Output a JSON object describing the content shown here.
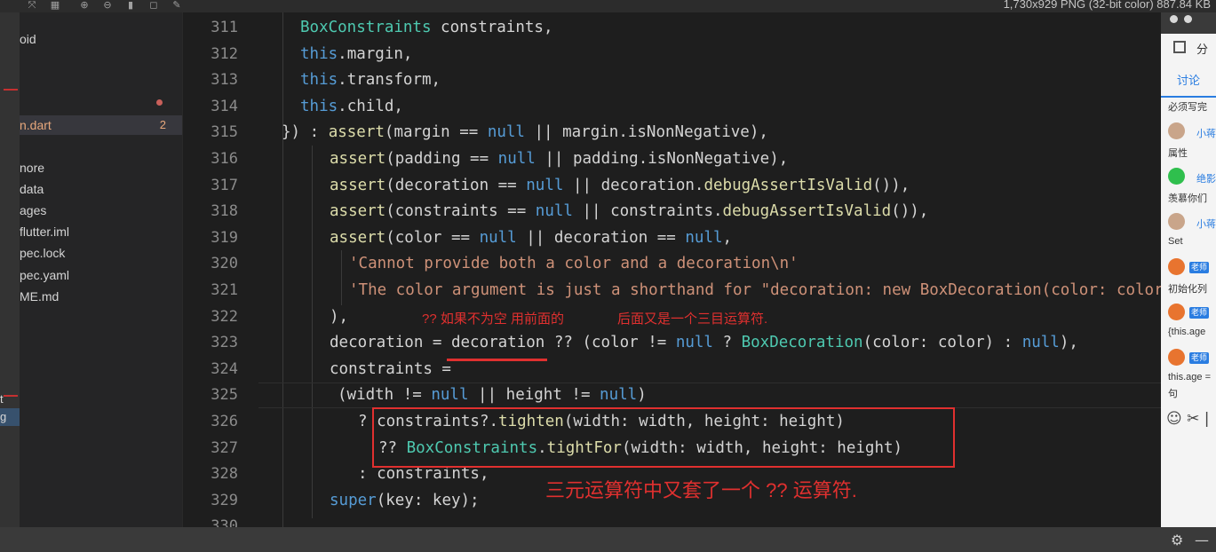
{
  "toolbar": {
    "image_info": "1,730x929 PNG (32-bit color) 887.84 KB"
  },
  "left_strip": {
    "labels": [
      "t",
      "g"
    ]
  },
  "explorer": {
    "items": [
      {
        "label": "oid",
        "badge": ""
      },
      {
        "label": "n.dart",
        "badge": "2"
      },
      {
        "label": "nore",
        "badge": ""
      },
      {
        "label": "data",
        "badge": ""
      },
      {
        "label": "ages",
        "badge": ""
      },
      {
        "label": "flutter.iml",
        "badge": ""
      },
      {
        "label": "pec.lock",
        "badge": ""
      },
      {
        "label": "pec.yaml",
        "badge": ""
      },
      {
        "label": "ME.md",
        "badge": ""
      }
    ]
  },
  "editor": {
    "line_numbers": [
      "311",
      "312",
      "313",
      "314",
      "315",
      "316",
      "317",
      "318",
      "319",
      "320",
      "321",
      "322",
      "323",
      "324",
      "325",
      "326",
      "327",
      "328",
      "329",
      "330"
    ]
  },
  "annotations": {
    "note_left": "?? 如果不为空 用前面的",
    "note_right": "后面又是一个三目运算符.",
    "note_bottom": "三元运算符中又套了一个 ?? 运算符."
  },
  "right_panel": {
    "split_label": "分",
    "tab": "讨论",
    "comments": [
      {
        "text": "必须写完"
      },
      {
        "name": "小蒋",
        "text": "属性"
      },
      {
        "name": "绝影",
        "text": "羡慕你们"
      },
      {
        "name": "小蒋",
        "text": "Set"
      },
      {
        "tag": "老师",
        "text": "初始化列"
      },
      {
        "tag": "老师",
        "text": "{this.age"
      },
      {
        "tag": "老师",
        "text": "this.age ="
      },
      {
        "text": "句"
      }
    ],
    "bottom_icons": "☺ ✂ |"
  },
  "colors": {
    "keyword": "#569cd6",
    "function": "#dcdcaa",
    "class": "#4ec9b0",
    "string": "#ce9178",
    "annotation": "#e0302f",
    "accent": "#2a7de1"
  }
}
